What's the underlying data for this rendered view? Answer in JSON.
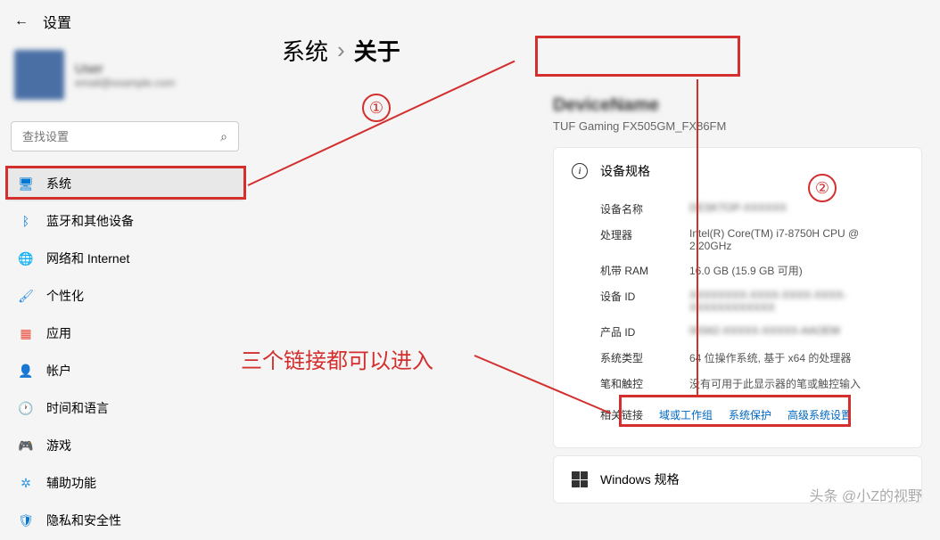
{
  "header": {
    "title": "设置"
  },
  "user": {
    "name": "User",
    "email": "email@example.com"
  },
  "search": {
    "placeholder": "查找设置"
  },
  "sidebar": {
    "items": [
      {
        "label": "系统",
        "icon": "system-icon",
        "active": true
      },
      {
        "label": "蓝牙和其他设备",
        "icon": "bluetooth-icon"
      },
      {
        "label": "网络和 Internet",
        "icon": "network-icon"
      },
      {
        "label": "个性化",
        "icon": "personalization-icon"
      },
      {
        "label": "应用",
        "icon": "apps-icon"
      },
      {
        "label": "帐户",
        "icon": "accounts-icon"
      },
      {
        "label": "时间和语言",
        "icon": "time-icon"
      },
      {
        "label": "游戏",
        "icon": "gaming-icon"
      },
      {
        "label": "辅助功能",
        "icon": "accessibility-icon"
      },
      {
        "label": "隐私和安全性",
        "icon": "privacy-icon"
      }
    ]
  },
  "breadcrumb": {
    "parent": "系统",
    "current": "关于"
  },
  "device": {
    "model": "TUF Gaming FX505GM_FX86FM"
  },
  "specs": {
    "title": "设备规格",
    "rows": [
      {
        "label": "设备名称",
        "value": "DESKTOP-XXXXXX",
        "blurred": true
      },
      {
        "label": "处理器",
        "value": "Intel(R) Core(TM) i7-8750H CPU @ 2.20GHz"
      },
      {
        "label": "机带 RAM",
        "value": "16.0 GB (15.9 GB 可用)"
      },
      {
        "label": "设备 ID",
        "value": "XXXXXXXX-XXXX-XXXX-XXXX-XXXXXXXXXXXX",
        "blurred": true
      },
      {
        "label": "产品 ID",
        "value": "00342-XXXXX-XXXXX-AAOEM",
        "blurred": true
      },
      {
        "label": "系统类型",
        "value": "64 位操作系统, 基于 x64 的处理器"
      },
      {
        "label": "笔和触控",
        "value": "没有可用于此显示器的笔或触控输入"
      }
    ],
    "related": {
      "label": "相关链接",
      "links": [
        "域或工作组",
        "系统保护",
        "高级系统设置"
      ]
    }
  },
  "windows_specs": {
    "title": "Windows 规格"
  },
  "annotations": {
    "circle1": "①",
    "circle2": "②",
    "text": "三个链接都可以进入",
    "watermark": "头条 @小Z的视野"
  }
}
